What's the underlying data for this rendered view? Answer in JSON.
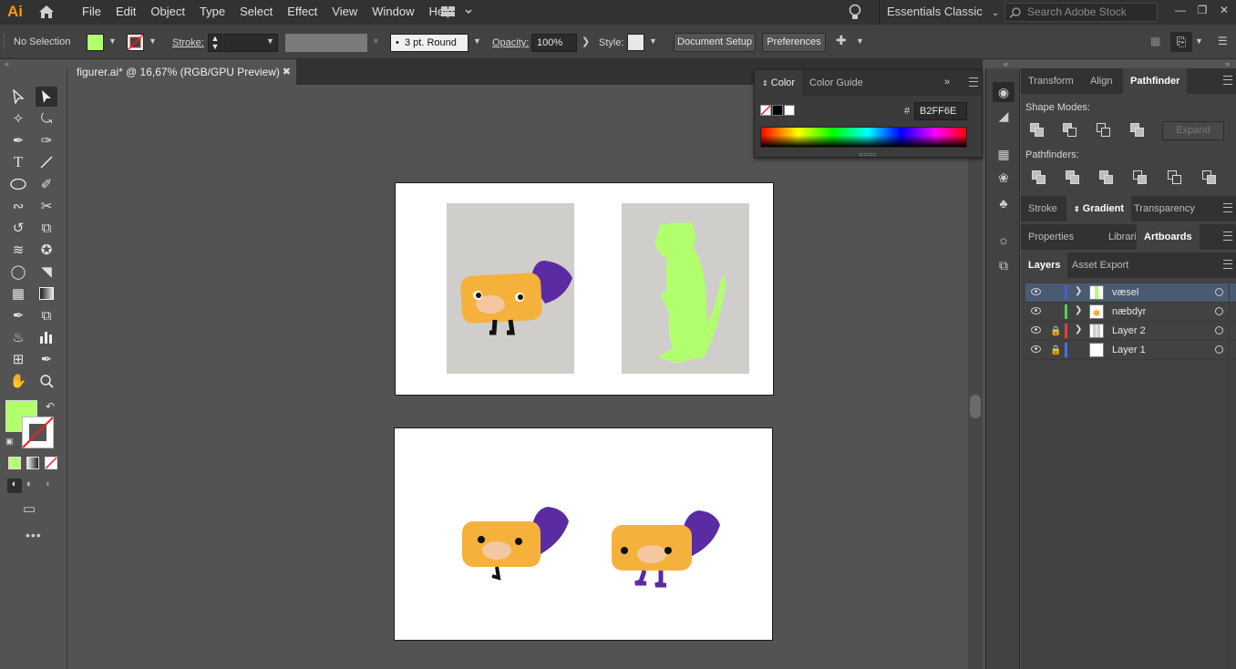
{
  "app": {
    "logo": "Ai"
  },
  "menu": [
    "File",
    "Edit",
    "Object",
    "Type",
    "Select",
    "Effect",
    "View",
    "Window",
    "Help"
  ],
  "workspace": {
    "name": "Essentials Classic"
  },
  "search": {
    "placeholder": "Search Adobe Stock"
  },
  "control_bar": {
    "selection": "No Selection",
    "fill_color": "#B2FF6E",
    "stroke_label": "Stroke:",
    "brush": "3 pt. Round",
    "opacity_label": "Opacity:",
    "opacity_value": "100%",
    "style_label": "Style:",
    "document_setup": "Document Setup",
    "preferences": "Preferences"
  },
  "document": {
    "tab_title": "figurer.ai* @ 16,67% (RGB/GPU Preview)"
  },
  "color_panel": {
    "tabs": [
      "Color",
      "Color Guide"
    ],
    "hash": "#",
    "hex": "B2FF6E"
  },
  "right_panels": {
    "top_tabs": [
      "Transform",
      "Align",
      "Pathfinder"
    ],
    "shape_modes_label": "Shape Modes:",
    "expand": "Expand",
    "pathfinders_label": "Pathfinders:",
    "mid_tabs": [
      "Stroke",
      "Gradient",
      "Transparency"
    ],
    "prop_tabs": [
      "Properties",
      "Libraries",
      "Artboards"
    ],
    "layer_tabs": [
      "Layers",
      "Asset Export"
    ]
  },
  "layers": [
    {
      "name": "væsel",
      "color": "#4a5ed6",
      "locked": false,
      "selected": true
    },
    {
      "name": "næbdyr",
      "color": "#4fd14f",
      "locked": false,
      "selected": false
    },
    {
      "name": "Layer 2",
      "color": "#e04040",
      "locked": true,
      "selected": false
    },
    {
      "name": "Layer 1",
      "color": "#4a6ee8",
      "locked": true,
      "selected": false
    }
  ],
  "colors": {
    "accent_fill": "#B2FF6E",
    "platypus_body": "#f4b23c",
    "platypus_tail": "#5b2ba3",
    "weasel": "#b2ff6e"
  }
}
